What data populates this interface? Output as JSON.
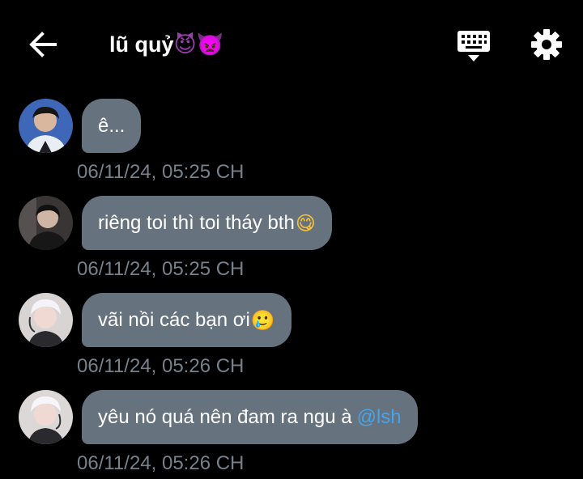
{
  "header": {
    "title": "lũ quỷ",
    "title_emojis": "😈👿",
    "back_icon": "arrow-left-icon",
    "keyboard_icon": "keyboard-icon",
    "settings_icon": "gear-icon"
  },
  "colors": {
    "background": "#000000",
    "bubble": "#66737f",
    "timestamp": "#76818b",
    "mention": "#4aa3e8"
  },
  "messages": [
    {
      "text": "ê...",
      "emoji": "",
      "mention": "",
      "timestamp": "06/11/24, 05:25 CH"
    },
    {
      "text": "riêng toi thì toi tháy bth",
      "emoji": "😋",
      "mention": "",
      "timestamp": "06/11/24, 05:25 CH"
    },
    {
      "text": "vãi nồi các bạn ơi",
      "emoji": "🥲",
      "mention": "",
      "timestamp": "06/11/24, 05:26 CH"
    },
    {
      "text": "yêu nó quá nên đam ra ngu à",
      "emoji": "",
      "mention": "@lsh",
      "timestamp": "06/11/24, 05:26 CH"
    }
  ]
}
